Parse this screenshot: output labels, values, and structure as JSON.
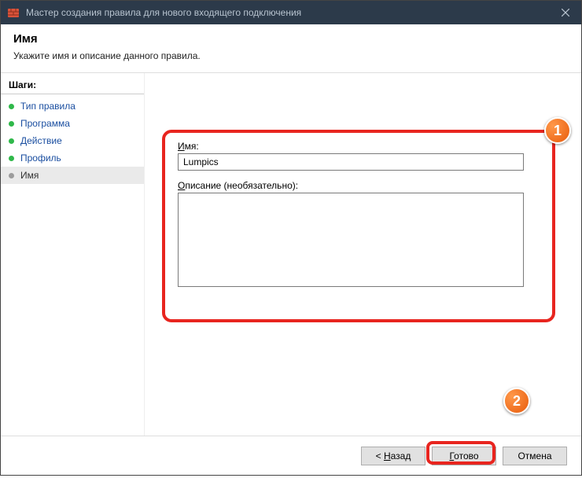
{
  "titlebar": {
    "title": "Мастер создания правила для нового входящего подключения"
  },
  "header": {
    "title": "Имя",
    "subtitle": "Укажите имя и описание данного правила."
  },
  "sidebar": {
    "steps_label": "Шаги:",
    "items": [
      {
        "label": "Тип правила"
      },
      {
        "label": "Программа"
      },
      {
        "label": "Действие"
      },
      {
        "label": "Профиль"
      },
      {
        "label": "Имя"
      }
    ]
  },
  "form": {
    "name_label_pre": "И",
    "name_label_rest": "мя:",
    "name_value": "Lumpics",
    "desc_label_pre": "О",
    "desc_label_rest": "писание (необязательно):",
    "desc_value": ""
  },
  "badges": {
    "b1": "1",
    "b2": "2"
  },
  "footer": {
    "back_pre": "< ",
    "back_u": "Н",
    "back_rest": "азад",
    "finish_u": "Г",
    "finish_rest": "отово",
    "cancel": "Отмена"
  }
}
